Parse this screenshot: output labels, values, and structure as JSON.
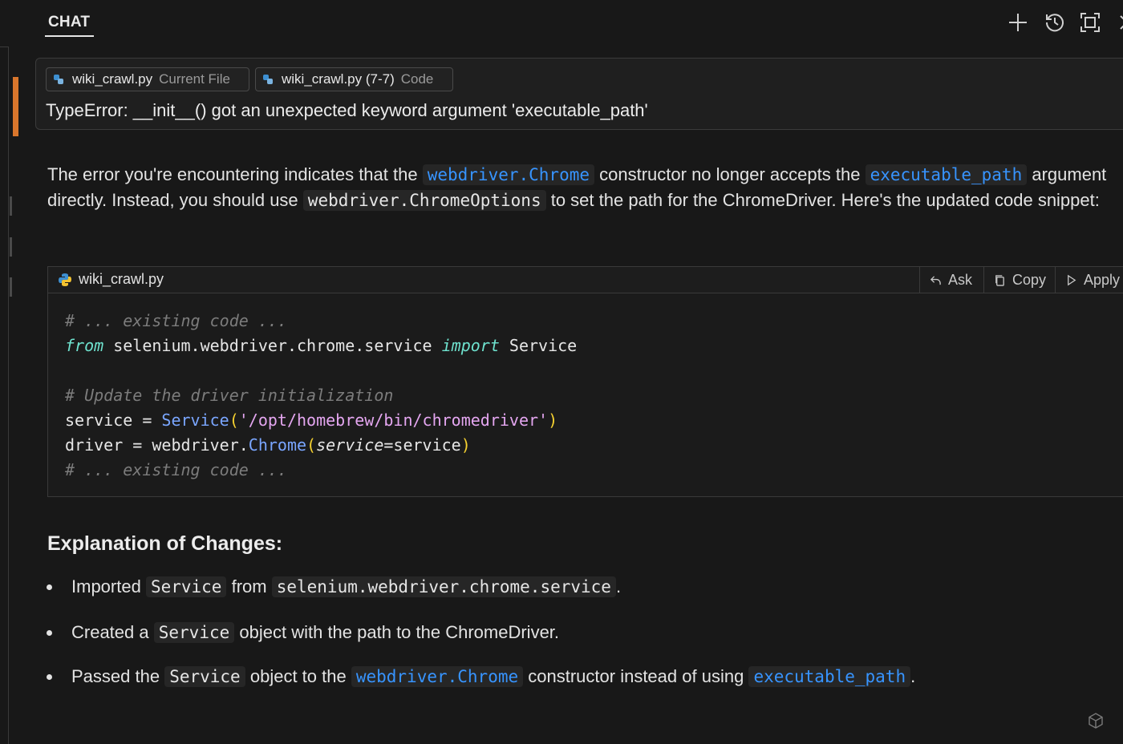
{
  "header": {
    "tab_label": "CHAT",
    "icons": [
      "plus-icon",
      "history-icon",
      "maximize-icon",
      "close-icon"
    ]
  },
  "context": {
    "pills": [
      {
        "file": "wiki_crawl.py",
        "kind": "Current File"
      },
      {
        "file": "wiki_crawl.py (7-7)",
        "kind": "Code"
      }
    ],
    "query": "TypeError: __init__() got an unexpected keyword argument 'executable_path'"
  },
  "response": {
    "p1": "The error you're encountering indicates that the",
    "p1_code1": "webdriver.Chrome",
    "p1_mid": "constructor no longer accepts the",
    "p1_code2": "executable_path",
    "p2": "argument directly. Instead, you should use",
    "p2_code": "webdriver.ChromeOptions",
    "p2_end": "to set the path for the ChromeDriver. Here's the updated code snippet:"
  },
  "codeblock": {
    "filename": "wiki_crawl.py",
    "buttons": {
      "ask": "Ask",
      "copy": "Copy",
      "apply": "Apply"
    },
    "lines": {
      "l1": "# ... existing code ...",
      "l2_kw1": "from",
      "l2_mod": " selenium.webdriver.chrome.service ",
      "l2_kw2": "import",
      "l2_name": " Service",
      "l4": "# Update the driver initialization",
      "l5_a": "service = ",
      "l5_fn": "Service",
      "l5_p1": "(",
      "l5_str": "'/opt/homebrew/bin/chromedriver'",
      "l5_p2": ")",
      "l6_a": "driver = webdriver.",
      "l6_fn": "Chrome",
      "l6_p1": "(",
      "l6_arg": "service",
      "l6_b": "=service",
      "l6_p2": ")",
      "l7": "# ... existing code ..."
    }
  },
  "explanation": {
    "heading": "Explanation of Changes:",
    "b1_a": "Imported",
    "b1_code1": "Service",
    "b1_b": "from",
    "b1_code2": "selenium.webdriver.chrome.service",
    "b1_end": ".",
    "b2_a": "Created a",
    "b2_code": "Service",
    "b2_b": "object with the path to the ChromeDriver.",
    "b3_a": "Passed the",
    "b3_code1": "Service",
    "b3_b": "object to the",
    "b3_code2": "webdriver.Chrome",
    "b3_c": "constructor instead of using",
    "b3_code3": "executable_path",
    "b3_end": "."
  },
  "colors": {
    "background": "#181818",
    "link_code": "#3794ff",
    "accent_orange": "#d9762c"
  }
}
